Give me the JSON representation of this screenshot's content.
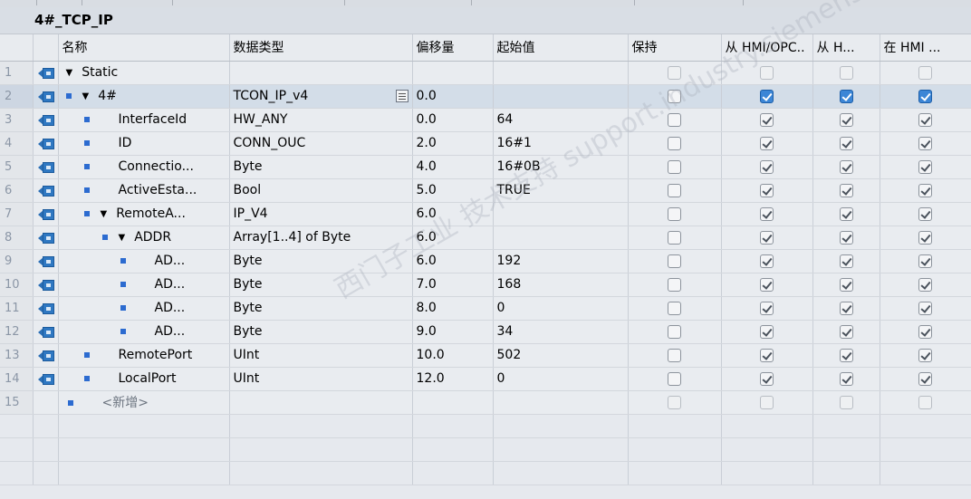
{
  "block": {
    "title": "4#_TCP_IP"
  },
  "columns": {
    "name": "名称",
    "datatype": "数据类型",
    "offset": "偏移量",
    "start": "起始值",
    "retain": "保持",
    "hmi1": "从 HMI/OPC..",
    "hmi2": "从 H...",
    "hmi3": "在 HMI ..."
  },
  "rows": [
    {
      "num": "1",
      "name": "Static",
      "type": "",
      "offset": "",
      "start": "",
      "retain": false,
      "hmi1": false,
      "hmi2": false,
      "hmi3": false
    },
    {
      "num": "2",
      "name": "4#",
      "type": "TCON_IP_v4",
      "offset": "0.0",
      "start": "",
      "retain": false,
      "hmi1": true,
      "hmi2": true,
      "hmi3": true
    },
    {
      "num": "3",
      "name": "InterfaceId",
      "type": "HW_ANY",
      "offset": "0.0",
      "start": "64",
      "retain": false,
      "hmi1": true,
      "hmi2": true,
      "hmi3": true
    },
    {
      "num": "4",
      "name": "ID",
      "type": "CONN_OUC",
      "offset": "2.0",
      "start": "16#1",
      "retain": false,
      "hmi1": true,
      "hmi2": true,
      "hmi3": true
    },
    {
      "num": "5",
      "name": "Connectio...",
      "type": "Byte",
      "offset": "4.0",
      "start": "16#0B",
      "retain": false,
      "hmi1": true,
      "hmi2": true,
      "hmi3": true
    },
    {
      "num": "6",
      "name": "ActiveEsta...",
      "type": "Bool",
      "offset": "5.0",
      "start": "TRUE",
      "retain": false,
      "hmi1": true,
      "hmi2": true,
      "hmi3": true
    },
    {
      "num": "7",
      "name": "RemoteA...",
      "type": "IP_V4",
      "offset": "6.0",
      "start": "",
      "retain": false,
      "hmi1": true,
      "hmi2": true,
      "hmi3": true
    },
    {
      "num": "8",
      "name": "ADDR",
      "type": "Array[1..4] of Byte",
      "offset": "6.0",
      "start": "",
      "retain": false,
      "hmi1": true,
      "hmi2": true,
      "hmi3": true
    },
    {
      "num": "9",
      "name": "AD...",
      "type": "Byte",
      "offset": "6.0",
      "start": "192",
      "retain": false,
      "hmi1": true,
      "hmi2": true,
      "hmi3": true
    },
    {
      "num": "10",
      "name": "AD...",
      "type": "Byte",
      "offset": "7.0",
      "start": "168",
      "retain": false,
      "hmi1": true,
      "hmi2": true,
      "hmi3": true
    },
    {
      "num": "11",
      "name": "AD...",
      "type": "Byte",
      "offset": "8.0",
      "start": "0",
      "retain": false,
      "hmi1": true,
      "hmi2": true,
      "hmi3": true
    },
    {
      "num": "12",
      "name": "AD...",
      "type": "Byte",
      "offset": "9.0",
      "start": "34",
      "retain": false,
      "hmi1": true,
      "hmi2": true,
      "hmi3": true
    },
    {
      "num": "13",
      "name": "RemotePort",
      "type": "UInt",
      "offset": "10.0",
      "start": "502",
      "retain": false,
      "hmi1": true,
      "hmi2": true,
      "hmi3": true
    },
    {
      "num": "14",
      "name": "LocalPort",
      "type": "UInt",
      "offset": "12.0",
      "start": "0",
      "retain": false,
      "hmi1": true,
      "hmi2": true,
      "hmi3": true
    },
    {
      "num": "15",
      "name": "<新增>",
      "type": "",
      "offset": "",
      "start": "",
      "retain": false,
      "hmi1": false,
      "hmi2": false,
      "hmi3": false
    }
  ],
  "watermark": "西门子工业 技术支持 support.industry.siemens.com/cs"
}
